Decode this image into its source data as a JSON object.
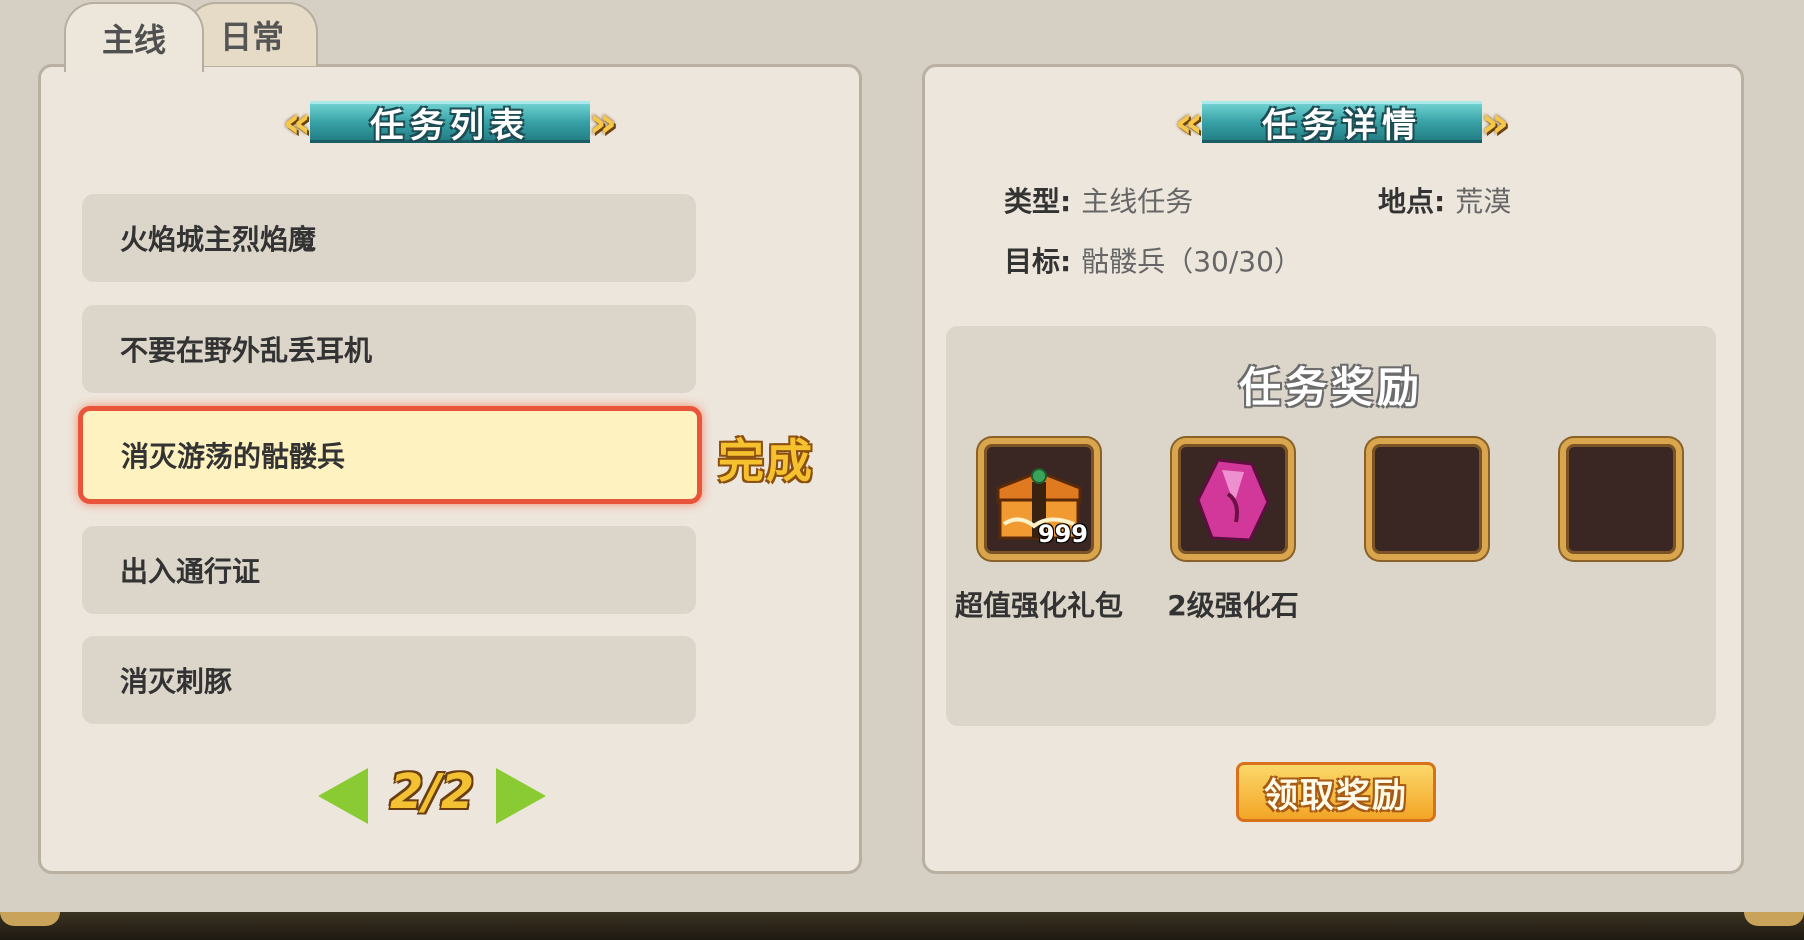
{
  "tabs": {
    "main": "主线",
    "daily": "日常"
  },
  "quest_list": {
    "title": "任务列表",
    "items": [
      "火焰城主烈焰魔",
      "不要在野外乱丢耳机",
      "消灭游荡的骷髅兵",
      "出入通行证",
      "消灭刺豚"
    ],
    "selected_index": 2,
    "done_label": "完成",
    "page": "2/2"
  },
  "detail": {
    "title": "任务详情",
    "type_label": "类型:",
    "type_value": "主线任务",
    "location_label": "地点:",
    "location_value": "荒漠",
    "target_label": "目标:",
    "target_value": "骷髅兵（30/30）",
    "rewards_title": "任务奖励",
    "rewards": [
      {
        "name": "超值强化礼包",
        "qty": "999",
        "icon": "gift-chest-icon"
      },
      {
        "name": "2级强化石",
        "qty": "",
        "icon": "pink-crystal-icon"
      },
      {
        "name": "",
        "qty": "",
        "icon": "empty-slot"
      },
      {
        "name": "",
        "qty": "",
        "icon": "empty-slot"
      }
    ],
    "claim_button": "领取奖励"
  },
  "colors": {
    "selected_border": "#e8553a",
    "banner_teal": "#38a2a6",
    "gold": "#f3c233",
    "arrow_green": "#8acb33"
  }
}
